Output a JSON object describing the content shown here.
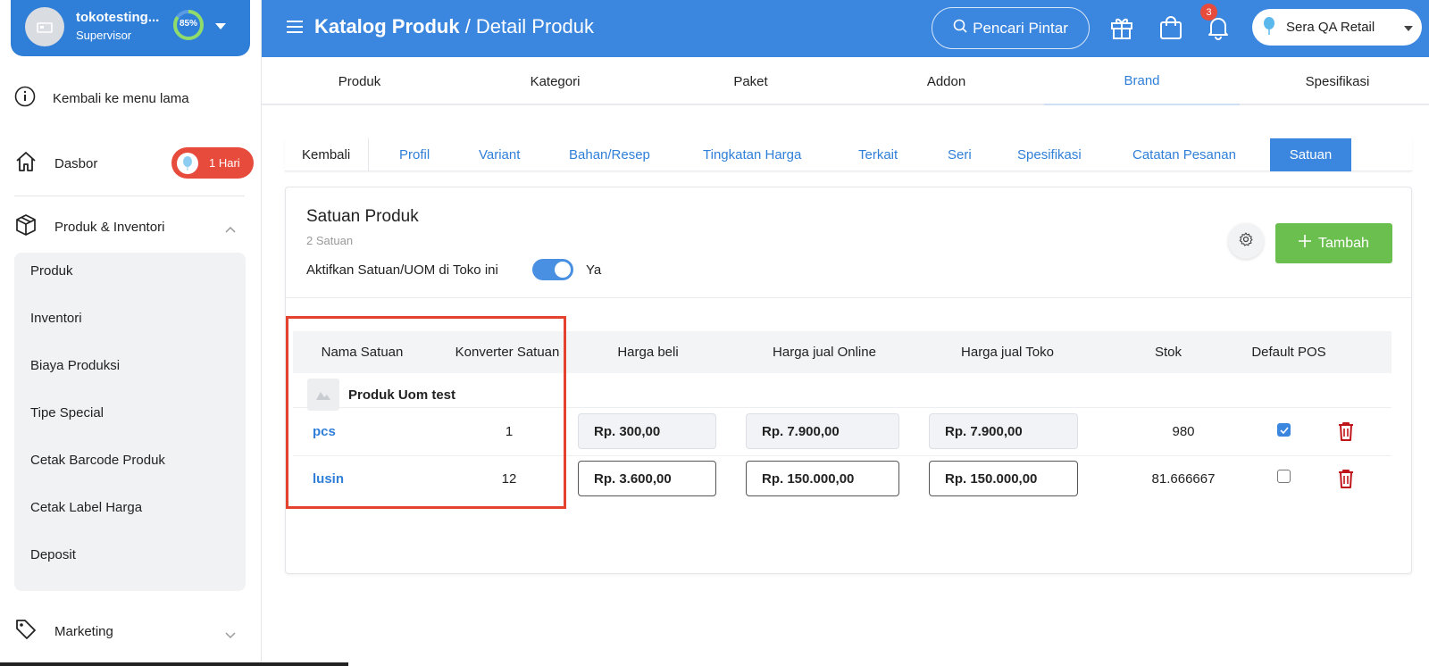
{
  "user": {
    "name": "tokotesting...",
    "role": "Supervisor",
    "progress": "85%"
  },
  "sidebar": {
    "back_old_menu": "Kembali ke menu lama",
    "dasbor": "Dasbor",
    "dasbor_badge": "1 Hari",
    "produk_inventori": "Produk & Inventori",
    "submenu": [
      "Produk",
      "Inventori",
      "Biaya Produksi",
      "Tipe Special",
      "Cetak Barcode Produk",
      "Cetak Label Harga",
      "Deposit"
    ],
    "marketing": "Marketing"
  },
  "header": {
    "crumb_main": "Katalog Produk",
    "crumb_sep": " / ",
    "crumb_sub": "Detail Produk",
    "smart_search": "Pencari Pintar",
    "notif_count": "3",
    "store_name": "Sera QA Retail"
  },
  "main_tabs": [
    "Produk",
    "Kategori",
    "Paket",
    "Addon",
    "Brand",
    "Spesifikasi"
  ],
  "main_tab_active": "Brand",
  "sub_tabs": {
    "back": "Kembali",
    "items": [
      "Profil",
      "Variant",
      "Bahan/Resep",
      "Tingkatan Harga",
      "Terkait",
      "Seri",
      "Spesifikasi",
      "Catatan Pesanan"
    ],
    "active": "Satuan"
  },
  "card": {
    "title": "Satuan Produk",
    "count": "2 Satuan",
    "toggle_label": "Aktifkan Satuan/UOM di Toko ini",
    "toggle_value": "Ya",
    "toggle_on": true,
    "add_button": "Tambah"
  },
  "table": {
    "headers": [
      "Nama Satuan",
      "Konverter Satuan",
      "Harga beli",
      "Harga jual Online",
      "Harga jual Toko",
      "Stok",
      "Default POS"
    ],
    "group_name": "Produk Uom test",
    "rows": [
      {
        "name": "pcs",
        "converter": "1",
        "harga_beli": "Rp. 300,00",
        "harga_online": "Rp. 7.900,00",
        "harga_toko": "Rp. 7.900,00",
        "stok": "980",
        "default_pos": true
      },
      {
        "name": "lusin",
        "converter": "12",
        "harga_beli": "Rp. 3.600,00",
        "harga_online": "Rp. 150.000,00",
        "harga_toko": "Rp. 150.000,00",
        "stok": "81.666667",
        "default_pos": false
      }
    ]
  },
  "colors": {
    "primary": "#3b86de",
    "success": "#6bbf4e",
    "danger": "#e74b3c",
    "trash": "#c0141b",
    "highlight": "#e5412f"
  }
}
